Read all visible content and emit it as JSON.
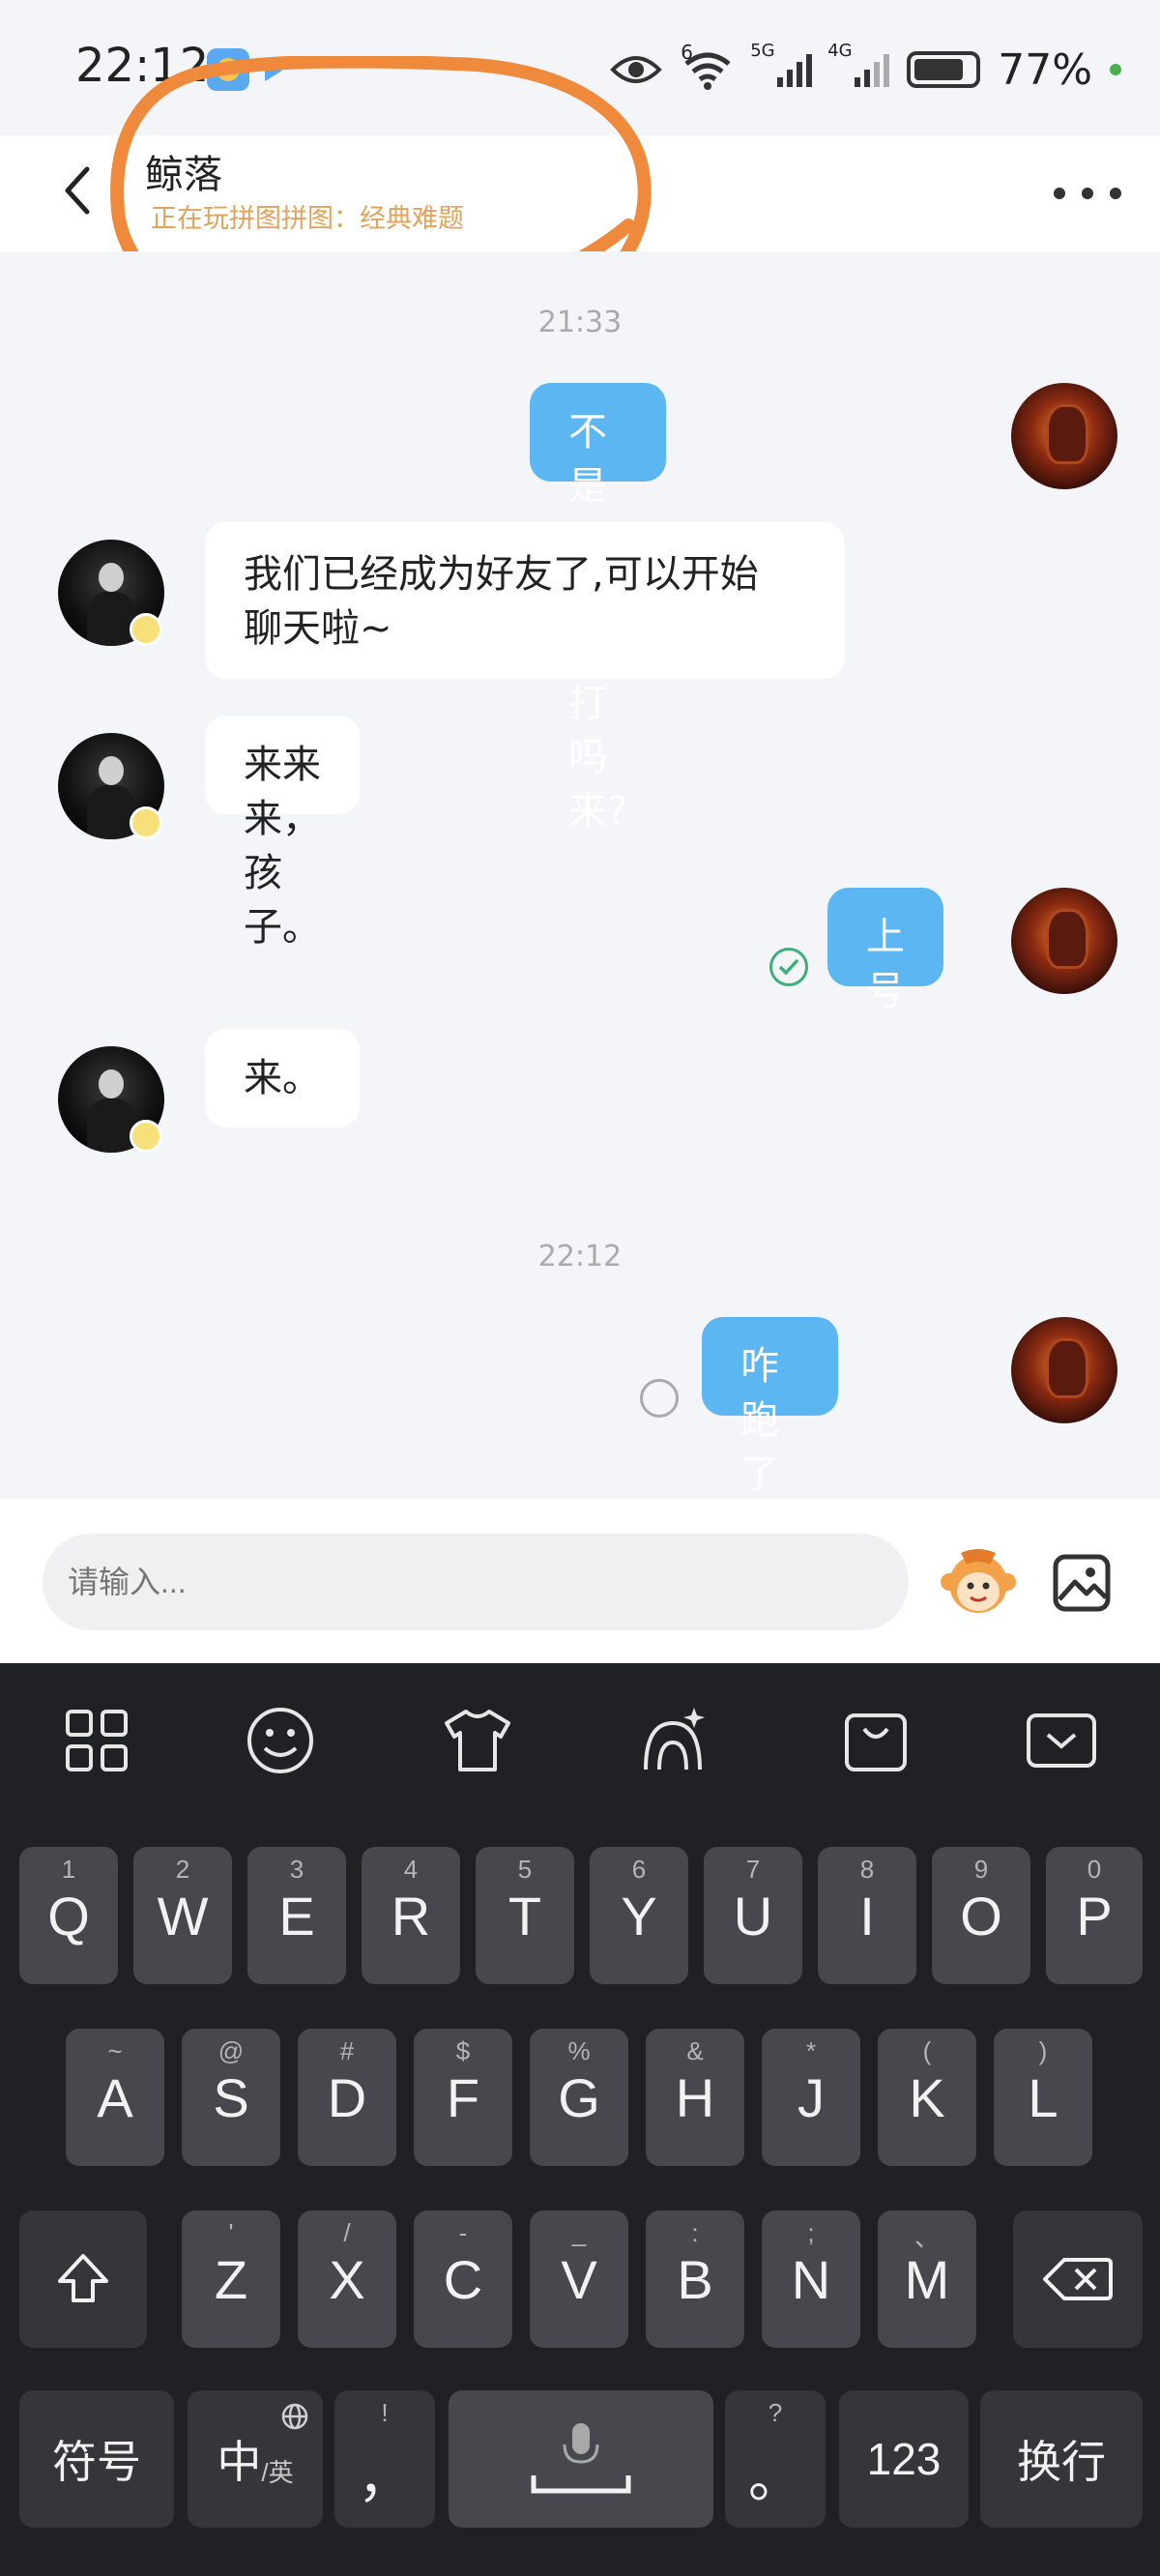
{
  "status_bar": {
    "time": "22:12",
    "network_6": "6",
    "network_5g": "5G",
    "network_4g": "4G",
    "battery": "77%",
    "battery_level": 0.77
  },
  "header": {
    "contact_name": "鲸落",
    "contact_status": "正在玩拼图拼图：经典难题"
  },
  "messages": [
    {
      "type": "time",
      "text": "21:33"
    },
    {
      "type": "out",
      "text": "不是要和我打吗来?"
    },
    {
      "type": "in",
      "text_line1": "我们已经成为好友了,可以开始",
      "text_line2": "聊天啦~"
    },
    {
      "type": "in",
      "text": "来来来，孩子。"
    },
    {
      "type": "out",
      "text": "上号",
      "status": "read"
    },
    {
      "type": "in",
      "text": "来。"
    },
    {
      "type": "time",
      "text": "22:12"
    },
    {
      "type": "out",
      "text": "咋跑了呀?",
      "status": "sending"
    }
  ],
  "input": {
    "placeholder": "请输入..."
  },
  "keyboard": {
    "row1": [
      {
        "main": "Q",
        "sub": "1"
      },
      {
        "main": "W",
        "sub": "2"
      },
      {
        "main": "E",
        "sub": "3"
      },
      {
        "main": "R",
        "sub": "4"
      },
      {
        "main": "T",
        "sub": "5"
      },
      {
        "main": "Y",
        "sub": "6"
      },
      {
        "main": "U",
        "sub": "7"
      },
      {
        "main": "I",
        "sub": "8"
      },
      {
        "main": "O",
        "sub": "9"
      },
      {
        "main": "P",
        "sub": "0"
      }
    ],
    "row2": [
      {
        "main": "A",
        "sub": "~"
      },
      {
        "main": "S",
        "sub": "@"
      },
      {
        "main": "D",
        "sub": "#"
      },
      {
        "main": "F",
        "sub": "$"
      },
      {
        "main": "G",
        "sub": "%"
      },
      {
        "main": "H",
        "sub": "&"
      },
      {
        "main": "J",
        "sub": "*"
      },
      {
        "main": "K",
        "sub": "("
      },
      {
        "main": "L",
        "sub": ")"
      }
    ],
    "row3": [
      {
        "main": "Z",
        "sub": "'"
      },
      {
        "main": "X",
        "sub": "/"
      },
      {
        "main": "C",
        "sub": "-"
      },
      {
        "main": "V",
        "sub": "_"
      },
      {
        "main": "B",
        "sub": ":"
      },
      {
        "main": "N",
        "sub": ";"
      },
      {
        "main": "M",
        "sub": "、"
      }
    ],
    "symbols_label": "符号",
    "lang_main": "中",
    "lang_sub": "/英",
    "comma_main": "，",
    "comma_sub": "!",
    "period_main": "。",
    "period_sub": "?",
    "numbers_label": "123",
    "enter_label": "换行"
  },
  "colors": {
    "outgoing_bubble": "#5bb6f2",
    "incoming_bubble": "#ffffff",
    "status_text": "#e0a35a",
    "annotation": "#ef8a3c",
    "keyboard_bg": "#202124",
    "key_bg": "#46484d"
  },
  "icons": {
    "back": "chevron-left-icon",
    "more": "more-dots-icon",
    "emoji": "monkey-face-icon",
    "image": "image-icon",
    "read": "check-circle-icon",
    "sending": "pending-circle-icon"
  }
}
